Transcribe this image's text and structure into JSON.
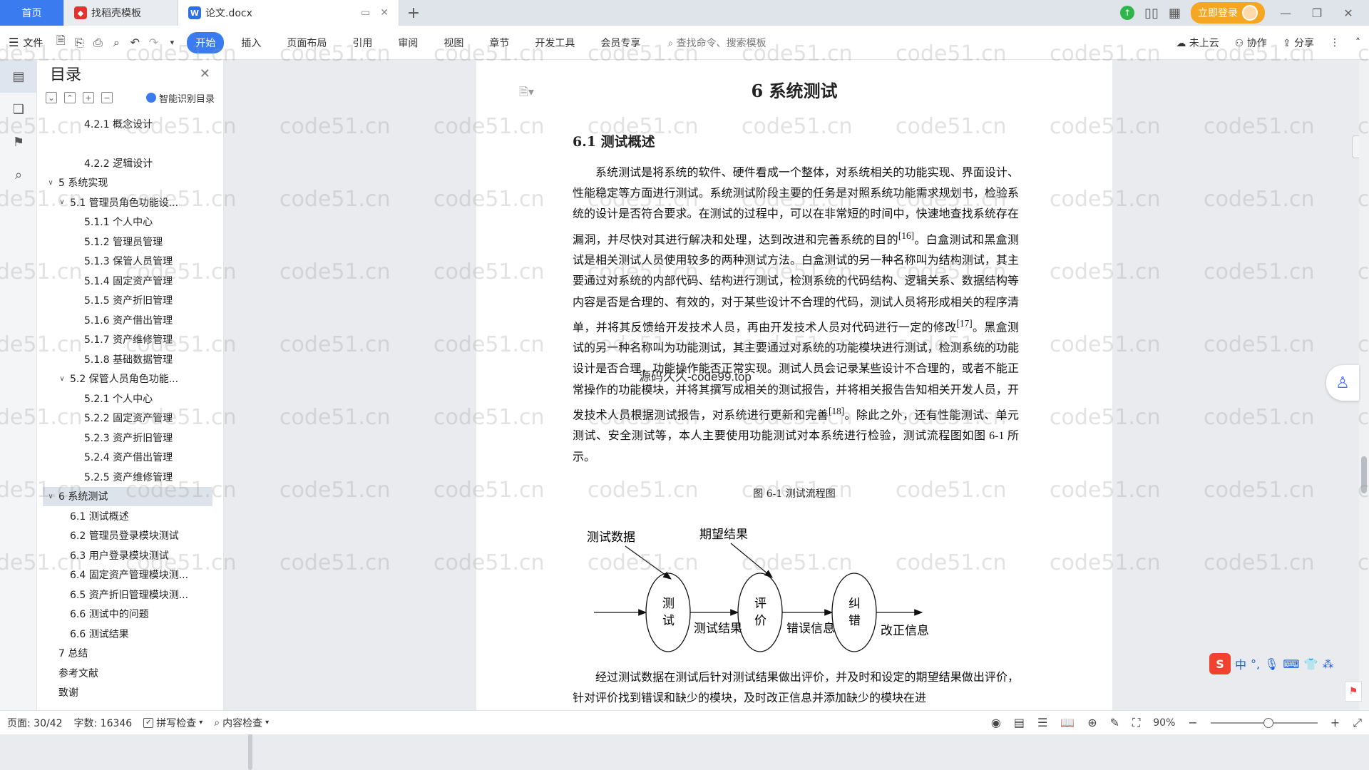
{
  "tabs": {
    "home": "首页",
    "template": "找稻壳模板",
    "doc": "论文.docx",
    "login": "立即登录"
  },
  "toolbar": {
    "file": "文件",
    "ribbon": [
      "开始",
      "插入",
      "页面布局",
      "引用",
      "审阅",
      "视图",
      "章节",
      "开发工具",
      "会员专享"
    ],
    "search": "查找命令、搜索模板",
    "cloud": "未上云",
    "collab": "协作",
    "share": "分享"
  },
  "toc": {
    "title": "目录",
    "smart": "智能识别目录",
    "items": [
      {
        "text": "4.2.1  概念设计",
        "level": 3,
        "caret": ""
      },
      {
        "text": "",
        "level": 3,
        "caret": ""
      },
      {
        "text": "4.2.2 逻辑设计",
        "level": 3,
        "caret": ""
      },
      {
        "text": "5  系统实现",
        "level": 1,
        "caret": "∨"
      },
      {
        "text": "5.1  管理员角色功能设...",
        "level": 2,
        "caret": "∨"
      },
      {
        "text": "5.1.1  个人中心",
        "level": 3,
        "caret": ""
      },
      {
        "text": "5.1.2  管理员管理",
        "level": 3,
        "caret": ""
      },
      {
        "text": "5.1.3  保管人员管理",
        "level": 3,
        "caret": ""
      },
      {
        "text": "5.1.4  固定资产管理",
        "level": 3,
        "caret": ""
      },
      {
        "text": "5.1.5  资产折旧管理",
        "level": 3,
        "caret": ""
      },
      {
        "text": "5.1.6  资产借出管理",
        "level": 3,
        "caret": ""
      },
      {
        "text": "5.1.7  资产维修管理",
        "level": 3,
        "caret": ""
      },
      {
        "text": "5.1.8  基础数据管理",
        "level": 3,
        "caret": ""
      },
      {
        "text": "5.2  保管人员角色功能...",
        "level": 2,
        "caret": "∨"
      },
      {
        "text": "5.2.1  个人中心",
        "level": 3,
        "caret": ""
      },
      {
        "text": "5.2.2  固定资产管理",
        "level": 3,
        "caret": ""
      },
      {
        "text": "5.2.3  资产折旧管理",
        "level": 3,
        "caret": ""
      },
      {
        "text": "5.2.4  资产借出管理",
        "level": 3,
        "caret": ""
      },
      {
        "text": "5.2.5  资产维修管理",
        "level": 3,
        "caret": ""
      },
      {
        "text": "6  系统测试",
        "level": 1,
        "caret": "∨",
        "selected": true
      },
      {
        "text": "6.1 测试概述",
        "level": 2,
        "caret": ""
      },
      {
        "text": "6.2 管理员登录模块测试",
        "level": 2,
        "caret": ""
      },
      {
        "text": "6.3 用户登录模块测试",
        "level": 2,
        "caret": ""
      },
      {
        "text": "6.4 固定资产管理模块测...",
        "level": 2,
        "caret": ""
      },
      {
        "text": "6.5 资产折旧管理模块测...",
        "level": 2,
        "caret": ""
      },
      {
        "text": "6.6 测试中的问题",
        "level": 2,
        "caret": ""
      },
      {
        "text": "6.6 测试结果",
        "level": 2,
        "caret": ""
      },
      {
        "text": "7  总结",
        "level": 1,
        "caret": ""
      },
      {
        "text": "参考文献",
        "level": 1,
        "caret": ""
      },
      {
        "text": "致谢",
        "level": 1,
        "caret": ""
      }
    ]
  },
  "document": {
    "chapter": "6  系统测试",
    "section": "6.1 测试概述",
    "para1_a": "系统测试是将系统的软件、硬件看成一个整体，对系统相关的功能实现、界面设计、性能稳定等方面进行测试。系统测试阶段主要的任务是对照系统功能需求规划书，检验系统的设计是否符合要求。在测试的过程中，可以在非常短的时间中，快速地查找系统存在漏洞，并尽快对其进行解决和处理，达到改进和完善系统的目的",
    "ref16": "[16]",
    "para1_b": "。白盒测试和黑盒测试是相关测试人员使用较多的两种测试方法。白盒测试的另一种名称叫为结构测试，其主要通过对系统的内部代码、结构进行测试，检测系统的代码结构、逻辑关系、数据结构等内容是否是合理的、有效的，对于某些设计不合理的代码，测试人员将形成相关的程序清单，并将其反馈给开发技术人员，再由开发技术人员对代码进行一定的修改",
    "ref17": "[17]",
    "para1_c": "。黑盒测试的另一种名称叫为功能测试，其主要通过对系统的功能模块进行测试，检测系统的功能设计是否合理，功能操作能否正常实现。测试人员会记录某些设计不合理的，或者不能正常操作的功能模块，并将其撰写成相关的测试报告，并将相关报告告知相关开发人员，开发技术人员根据测试报告，对系统进行更新和完善",
    "ref18": "[18]",
    "para1_d": "。除此之外，还有性能测试、单元测试、安全测试等，本人主要使用功能测试对本系统进行检验，测试流程图如图 6-1 所示。",
    "caption": "图 6-1 测试流程图",
    "para2": "经过测试数据在测试后针对测试结果做出评价，并及时和设定的期望结果做出评价，针对评价找到错误和缺少的模块，及时改正信息并添加缺少的模块在进",
    "watermark_center": "源码久久-code99.top"
  },
  "diagram": {
    "input": "测试数据",
    "expected": "期望结果",
    "node1": [
      "测",
      "试"
    ],
    "node2": [
      "评",
      "价"
    ],
    "node3": [
      "纠",
      "错"
    ],
    "edge1": "测试结果",
    "edge2": "错误信息",
    "edge3": "改正信息"
  },
  "status": {
    "page": "页面: 30/42",
    "words": "字数: 16346",
    "spell": "拼写检查",
    "content": "内容检查",
    "zoom": "90%"
  },
  "ime": {
    "zh": "中",
    "punct": "°,"
  },
  "watermark": "code51.cn"
}
